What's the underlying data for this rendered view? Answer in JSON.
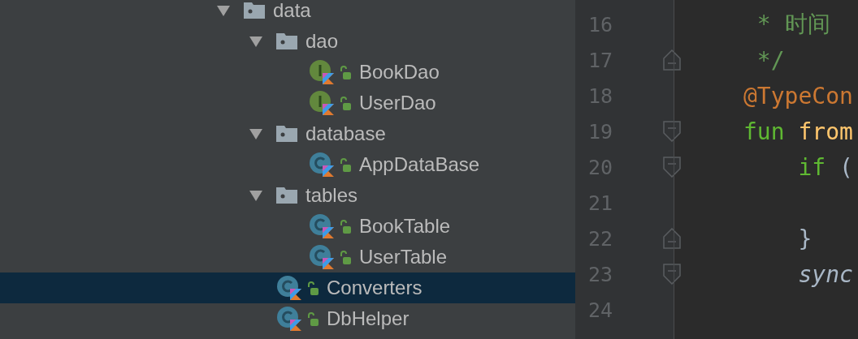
{
  "project_tree": [
    {
      "kind": "folder",
      "label": "data",
      "expanded": true,
      "selected": false,
      "children": [
        {
          "kind": "folder",
          "label": "dao",
          "expanded": true,
          "selected": false,
          "children": [
            {
              "kind": "interface",
              "label": "BookDao",
              "selected": false
            },
            {
              "kind": "interface",
              "label": "UserDao",
              "selected": false
            }
          ]
        },
        {
          "kind": "folder",
          "label": "database",
          "expanded": true,
          "selected": false,
          "children": [
            {
              "kind": "class",
              "label": "AppDataBase",
              "selected": false
            }
          ]
        },
        {
          "kind": "folder",
          "label": "tables",
          "expanded": true,
          "selected": false,
          "children": [
            {
              "kind": "class",
              "label": "BookTable",
              "selected": false
            },
            {
              "kind": "class",
              "label": "UserTable",
              "selected": false
            }
          ]
        },
        {
          "kind": "class",
          "label": "Converters",
          "selected": true
        },
        {
          "kind": "class",
          "label": "DbHelper",
          "selected": false
        }
      ]
    }
  ],
  "editor": {
    "lines": [
      {
        "number": "16",
        "kind": "plain",
        "tokens": [
          {
            "kind": "comment",
            "text": " * 时间"
          }
        ]
      },
      {
        "number": "17",
        "kind": "closer",
        "tokens": [
          {
            "kind": "comment",
            "text": " */"
          }
        ]
      },
      {
        "number": "18",
        "kind": "plain",
        "tokens": [
          {
            "kind": "annotation",
            "text": "@TypeCon"
          }
        ]
      },
      {
        "number": "19",
        "kind": "opener",
        "tokens": [
          {
            "kind": "keyword",
            "text": "fun "
          },
          {
            "kind": "function",
            "text": "from"
          }
        ]
      },
      {
        "number": "20",
        "kind": "opener",
        "tokens": [
          {
            "kind": "keyword",
            "text": "    if "
          },
          {
            "kind": "plain",
            "text": "("
          }
        ]
      },
      {
        "number": "21",
        "kind": "plain"
      },
      {
        "number": "22",
        "kind": "closer",
        "tokens": [
          {
            "kind": "plain",
            "text": "    }"
          }
        ]
      },
      {
        "number": "23",
        "kind": "opener",
        "tokens": [
          {
            "kind": "italic",
            "text": "    sync"
          }
        ]
      },
      {
        "number": "24",
        "kind": "plain"
      }
    ]
  }
}
